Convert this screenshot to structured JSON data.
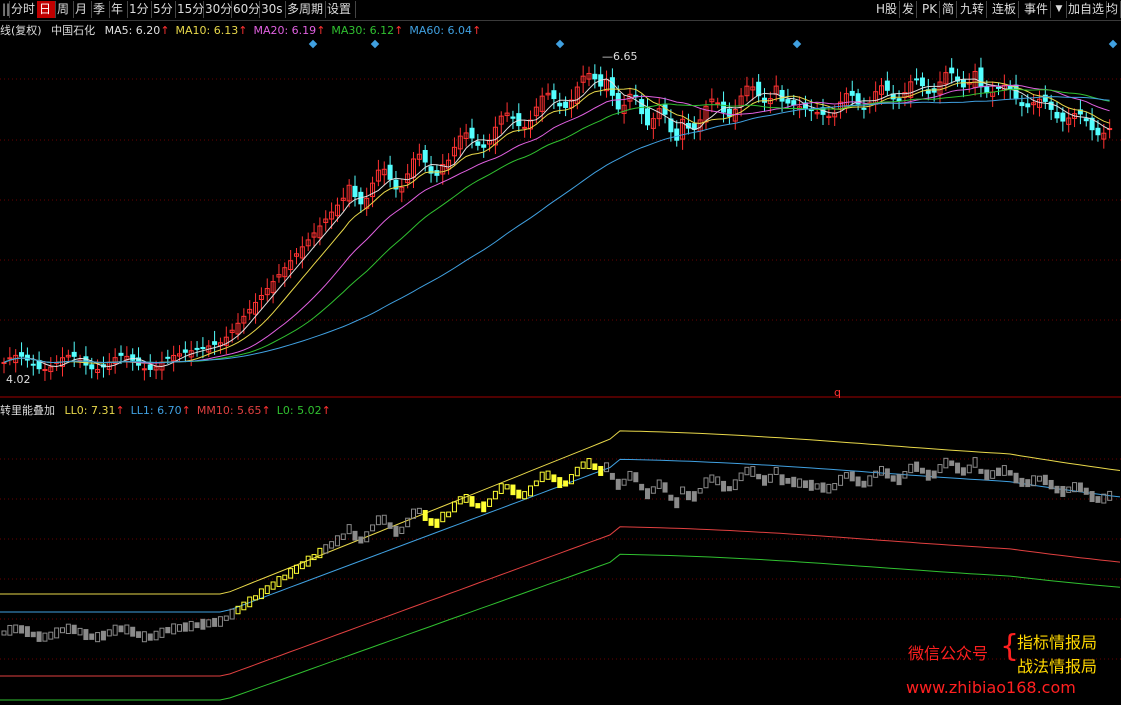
{
  "toolbar": {
    "left": [
      "||",
      "分时",
      "日",
      "周",
      "月",
      "季",
      "年",
      "1分",
      "5分",
      "15分",
      "30分",
      "60分",
      "30s",
      "多周期",
      "设置"
    ],
    "active": "日",
    "right": [
      "H股",
      "发",
      "PK",
      "简",
      "九转",
      "连板",
      "事件",
      "加自选",
      "均"
    ]
  },
  "main_panel": {
    "title": "线(复权)",
    "stock_name": "中国石化",
    "ma": [
      {
        "label": "MA5:",
        "value": "6.20",
        "color": "#e0e0e0",
        "arrow": "↑"
      },
      {
        "label": "MA10:",
        "value": "6.13",
        "color": "#e8d84a",
        "arrow": "↑"
      },
      {
        "label": "MA20:",
        "value": "6.19",
        "color": "#e060e0",
        "arrow": "↑"
      },
      {
        "label": "MA30:",
        "value": "6.12",
        "color": "#30c030",
        "arrow": "↑"
      },
      {
        "label": "MA60:",
        "value": "6.04",
        "color": "#40a0e0",
        "arrow": "↑"
      }
    ],
    "high_label": "6.65",
    "low_label": "4.02"
  },
  "sub_panel": {
    "title": "转里能叠加",
    "lines": [
      {
        "label": "LL0:",
        "value": "7.31",
        "color": "#e8d84a",
        "arrow": "↑"
      },
      {
        "label": "LL1:",
        "value": "6.70",
        "color": "#40a0e0",
        "arrow": "↑"
      },
      {
        "label": "MM10:",
        "value": "5.65",
        "color": "#e04040",
        "arrow": "↑"
      },
      {
        "label": "L0:",
        "value": "5.02",
        "color": "#30c030",
        "arrow": "↑"
      }
    ],
    "marker": "q"
  },
  "watermark": {
    "wechat": "微信公众号",
    "brace": "{",
    "line1": "指标情报局",
    "line2": "战法情报局",
    "url": "www.zhibiao168.com"
  },
  "colors": {
    "up": "#ff3232",
    "down": "#54ffff",
    "yellow_bar": "#ffff33",
    "gray_bar": "#8a8a8a",
    "grid": "#6b0000"
  },
  "icons": [
    "diamond-marker-icon",
    "caret-down-icon"
  ]
}
